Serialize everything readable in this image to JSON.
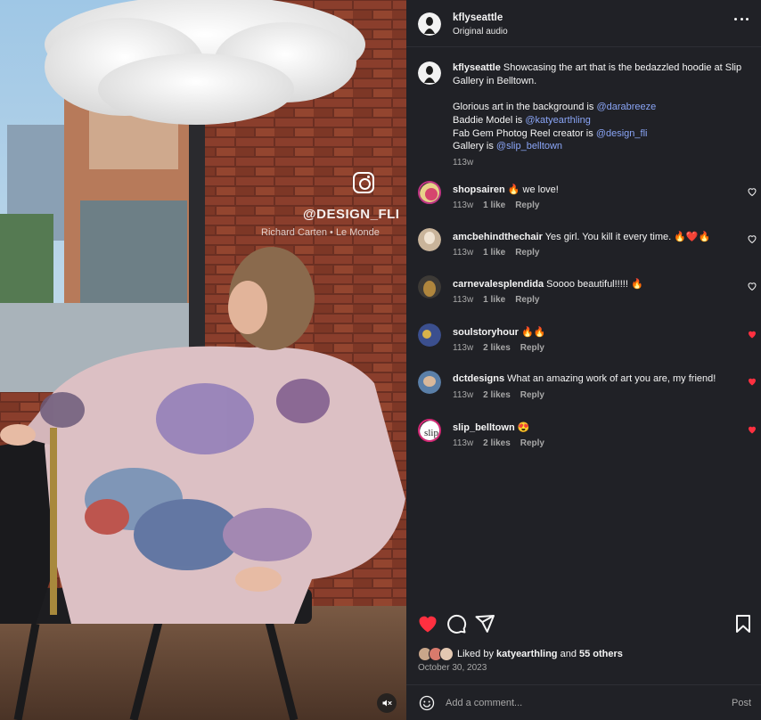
{
  "media": {
    "watermark_handle": "@DESIGN_FLI",
    "watermark_credit": "Richard Carten • Le Monde",
    "watermark_icon": "instagram-icon",
    "mute_icon": "speaker-muted-icon"
  },
  "header": {
    "username": "kflyseattle",
    "audio": "Original audio",
    "more_icon": "more-horizontal-icon"
  },
  "caption": {
    "username": "kflyseattle",
    "text": "Showcasing the art that is the bedazzled hoodie at Slip Gallery in Belltown.",
    "line1_prefix": "Glorious art in the background is",
    "line1_mention": "@darabreeze",
    "line2_prefix": "Baddie Model is",
    "line2_mention": "@katyearthling",
    "line3_prefix": "Fab Gem Photog Reel creator is",
    "line3_mention": "@design_fli",
    "line4_prefix": "Gallery is",
    "line4_mention": "@slip_belltown",
    "age": "113w"
  },
  "comments": [
    {
      "user": "shopsairen",
      "text": "🔥 we love!",
      "age": "113w",
      "likes": "1 like",
      "reply": "Reply",
      "liked": false,
      "avatar": "#d6456e"
    },
    {
      "user": "amcbehindthechair",
      "text": "Yes girl. You kill it every time. 🔥❤️🔥",
      "age": "113w",
      "likes": "1 like",
      "reply": "Reply",
      "liked": false,
      "avatar": "#c9b49a"
    },
    {
      "user": "carnevalesplendida",
      "text": "Soooo beautiful!!!!! 🔥",
      "age": "113w",
      "likes": "1 like",
      "reply": "Reply",
      "liked": false,
      "avatar": "#b0863d"
    },
    {
      "user": "soulstoryhour",
      "text": "🔥🔥",
      "age": "113w",
      "likes": "2 likes",
      "reply": "Reply",
      "liked": true,
      "avatar": "#3b4f8e"
    },
    {
      "user": "dctdesigns",
      "text": "What an amazing work of art you are, my friend!",
      "age": "113w",
      "likes": "2 likes",
      "reply": "Reply",
      "liked": true,
      "avatar": "#5a7fa8"
    },
    {
      "user": "slip_belltown",
      "text": "😍",
      "age": "113w",
      "likes": "2 likes",
      "reply": "Reply",
      "liked": true,
      "avatar": "#ffffff"
    }
  ],
  "actions": {
    "like_icon": "heart-filled-icon",
    "comment_icon": "comment-icon",
    "share_icon": "send-icon",
    "save_icon": "bookmark-icon",
    "liked_by_prefix": "Liked by",
    "liked_by_user": "katyearthling",
    "liked_by_and": "and",
    "liked_by_others": "55 others",
    "date": "October 30, 2023"
  },
  "add_comment": {
    "placeholder": "Add a comment...",
    "post_label": "Post",
    "emoji_icon": "smiley-icon"
  },
  "colors": {
    "panel_bg": "#202126",
    "link": "#8aa5f6",
    "like_red": "#ff3040",
    "muted_text": "#a8a8a8"
  }
}
